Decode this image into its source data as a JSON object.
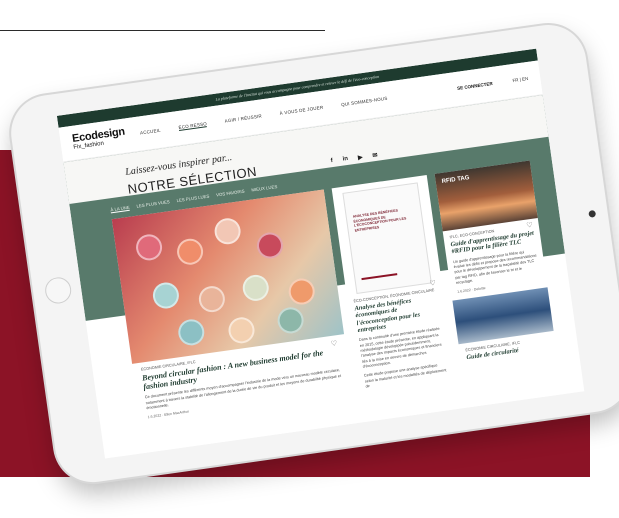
{
  "banner": "La plateforme de l'Institut qui vous accompagne pour comprendre et relever le défi de l'éco-conception",
  "logo": {
    "main": "Ecodesign",
    "sub": "Fix_fashion"
  },
  "nav": [
    "ACCUEIL",
    "ÉCO RESSO",
    "AGIR / RÉUSSIR",
    "À VOUS DE JOUER",
    "QUI SOMMES-NOUS"
  ],
  "login": "SE CONNECTER",
  "lang": "FR | EN",
  "hero": {
    "tagline": "Laissez-vous inspirer par...",
    "title": "NOTRE SÉLECTION"
  },
  "social": [
    "f",
    "in",
    "▶",
    "✉"
  ],
  "filters": [
    "À LA UNE",
    "LES PLUS VUES",
    "LES PLUS LUES",
    "VOS FAVORIS",
    "MIEUX LUES"
  ],
  "cards": [
    {
      "category": "ÉCONOMIE CIRCULAIRE, IFLC",
      "title": "Beyond circular fashion : A new business model for the fashion industry",
      "body": "Ce document présente les différents moyen d'accompagner l'industrie de la mode vers un nouveau modèle circulaire, notamment à travers la stabilité de l'allongement de la durée de vie du produit et les moyens de durabilité physique et émotionnelle.",
      "meta": "1.6.2022 · Ellen MacArthur"
    },
    {
      "doc_title": "ANALYSE DES BÉNÉFICES ÉCONOMIQUES DE L'ÉCOCONCEPTION POUR LES ENTREPRISES",
      "category": "ÉCO-CONCEPTION, ÉCONOMIE CIRCULAIRE",
      "title": "Analyse des bénéfices économiques de l'écoconception pour les entreprises",
      "body": "Dans la continuité d'une première étude réalisée en 2015, cette étude présente, en appliquant la méthodologie développée précédemment, l'analyse des impacts économiques et financiers liés à la mise en oeuvre de démarches d'écoconception.",
      "body2": "Cette étude propose une analyse spécifique selon la maturité et les modalités de déploiement de"
    },
    {
      "logo": "RFID TAG",
      "category": "IFLC, ECO-CONCEPTION",
      "title": "Guide d'apprentissage du projet #RFID pour la filière TLC",
      "body": "Un guide d'apprentissage pour la filière qui évalue les défis et propose des recommandations pour le développement de la traçabilité des TLC par tag RFID, afin de favoriser le tri et le recyclage.",
      "meta": "1.6.2022 · Deloitte",
      "category2": "ÉCONOMIE CIRCULAIRE, IFLC",
      "title2": "Guide de circularité"
    }
  ]
}
